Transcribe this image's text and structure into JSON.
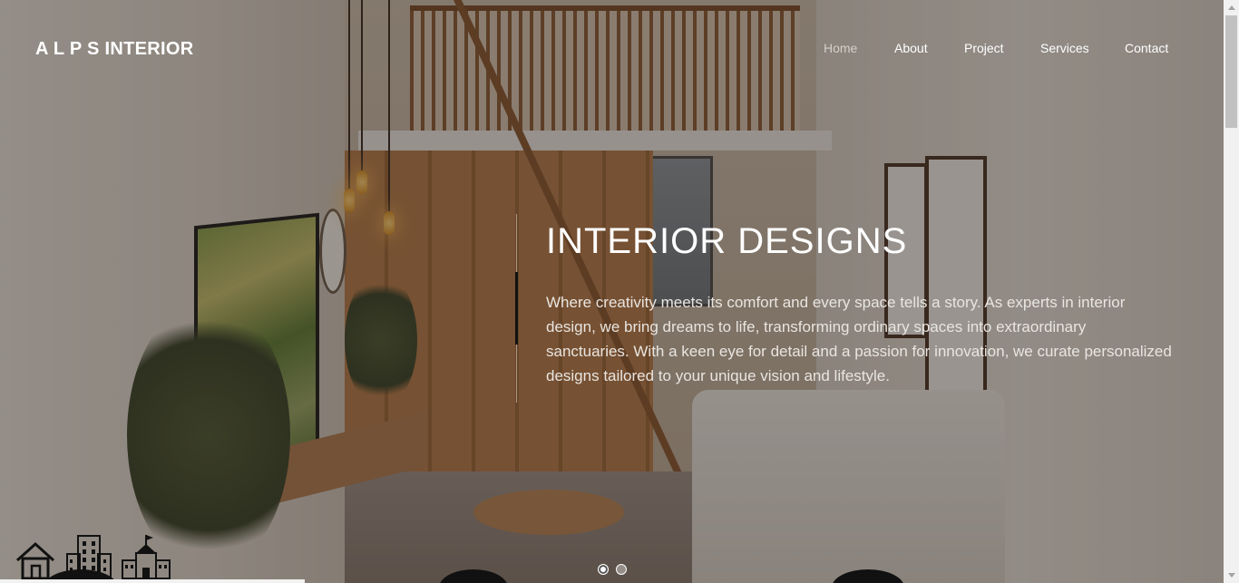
{
  "brand": {
    "name": "A L P S INTERIOR"
  },
  "nav": {
    "items": [
      {
        "label": "Home",
        "active": true
      },
      {
        "label": "About",
        "active": false
      },
      {
        "label": "Project",
        "active": false
      },
      {
        "label": "Services",
        "active": false
      },
      {
        "label": "Contact",
        "active": false
      }
    ]
  },
  "hero": {
    "title": "INTERIOR DESIGNS",
    "description": "Where creativity meets its comfort and every space tells a story. As experts in interior design, we bring dreams to life, transforming ordinary spaces into extraordinary sanctuaries. With a keen eye for detail and a passion for innovation, we curate personalized designs tailored to your unique vision and lifestyle.",
    "background_image": "living-room-loft-interior"
  },
  "carousel": {
    "slide_count": 2,
    "active_slide": 1
  },
  "decor_icons": [
    "house-icon",
    "apartment-building-icon",
    "school-building-icon"
  ],
  "colors": {
    "text_primary": "#ffffff",
    "nav_active": "#d4cfc9",
    "accent_line": "#111111"
  }
}
